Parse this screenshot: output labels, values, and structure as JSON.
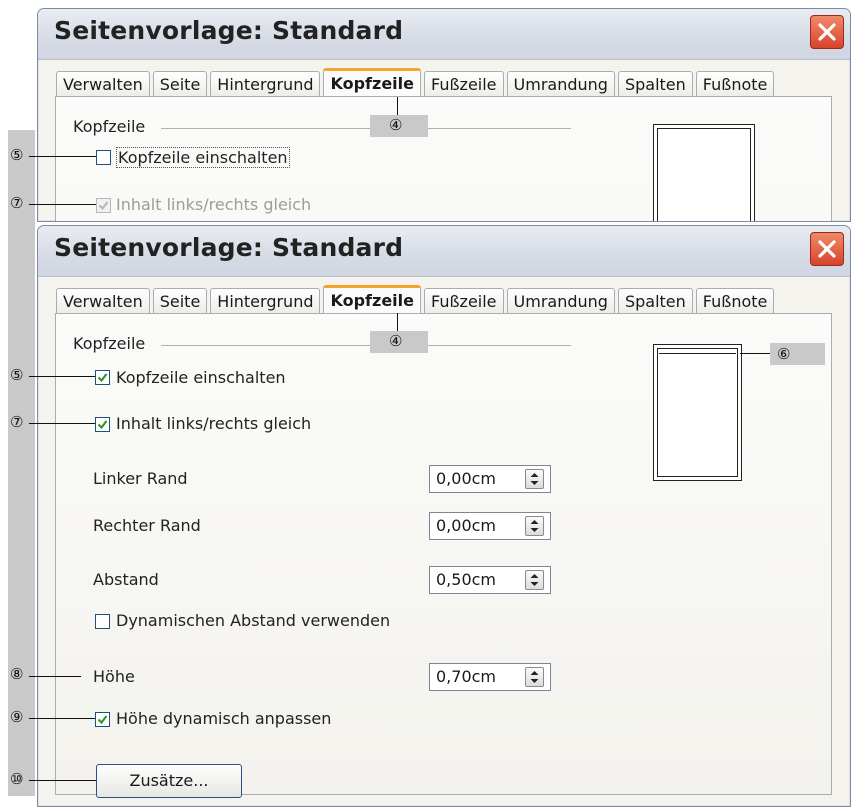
{
  "window_title": "Seitenvorlage: Standard",
  "tabs": [
    "Verwalten",
    "Seite",
    "Hintergrund",
    "Kopfzeile",
    "Fußzeile",
    "Umrandung",
    "Spalten",
    "Fußnote"
  ],
  "active_tab": "Kopfzeile",
  "section_label": "Kopfzeile",
  "checkboxes": {
    "enable_header": {
      "label": "Kopfzeile einschalten",
      "checked_top": false,
      "checked_bottom": true
    },
    "same_content": {
      "label": "Inhalt links/rechts gleich",
      "checked": true
    },
    "dynamic_spacing": {
      "label": "Dynamischen Abstand verwenden",
      "checked": false
    },
    "autofit_height": {
      "label": "Höhe dynamisch anpassen",
      "checked": true
    }
  },
  "fields": {
    "left_margin": {
      "label": "Linker Rand",
      "value": "0,00cm"
    },
    "right_margin": {
      "label": "Rechter Rand",
      "value": "0,00cm"
    },
    "spacing": {
      "label": "Abstand",
      "value": "0,50cm"
    },
    "height": {
      "label": "Höhe",
      "value": "0,70cm"
    }
  },
  "more_button": "Zusätze...",
  "callouts": {
    "c4": "④",
    "c5": "⑤",
    "c6": "⑥",
    "c7": "⑦",
    "c8": "⑧",
    "c9": "⑨",
    "c10": "⑩"
  },
  "colors": {
    "active_tab_accent": "#f6a52c",
    "close_button": "#d8432a",
    "checkmark": "#2a9a2a"
  }
}
